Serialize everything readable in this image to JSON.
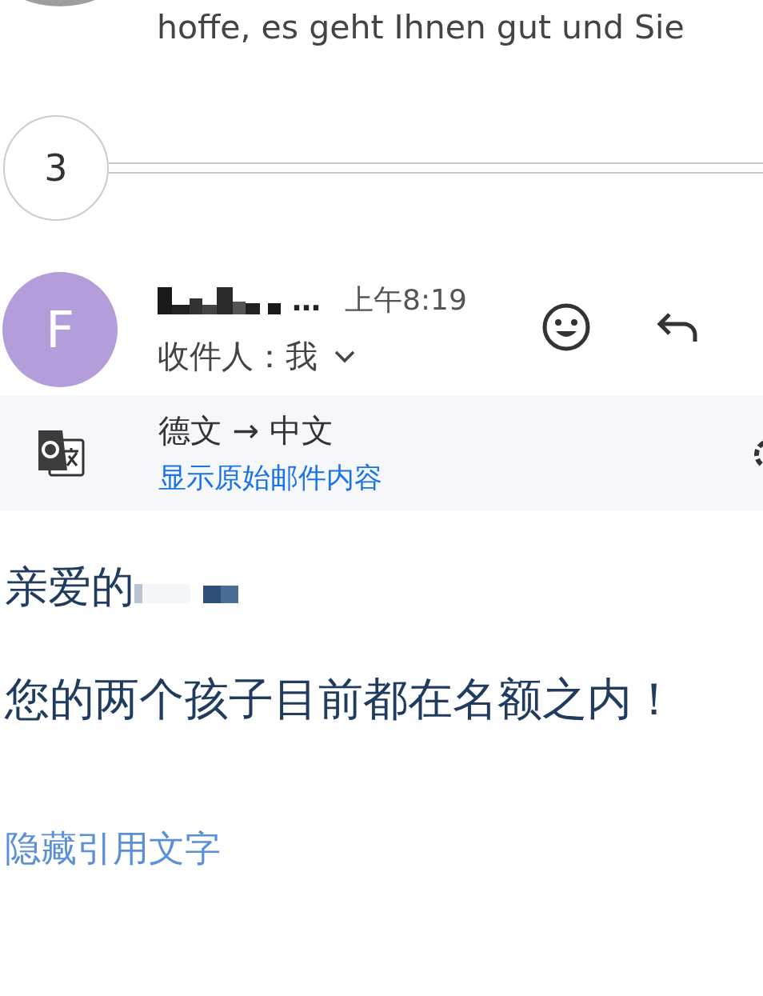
{
  "previous_message": {
    "snippet": "hoffe, es geht Ihnen gut und Sie"
  },
  "collapsed": {
    "count": "3"
  },
  "message": {
    "avatar_letter": "F",
    "sender_suffix": "…",
    "time": "上午8:19",
    "recipient": "收件人：我"
  },
  "translation": {
    "languages": "德文 → 中文",
    "show_original": "显示原始邮件内容"
  },
  "body": {
    "greeting": "亲爱的",
    "text": "您的两个孩子目前都在名额之内！"
  },
  "hide_quoted": "隐藏引用文字"
}
